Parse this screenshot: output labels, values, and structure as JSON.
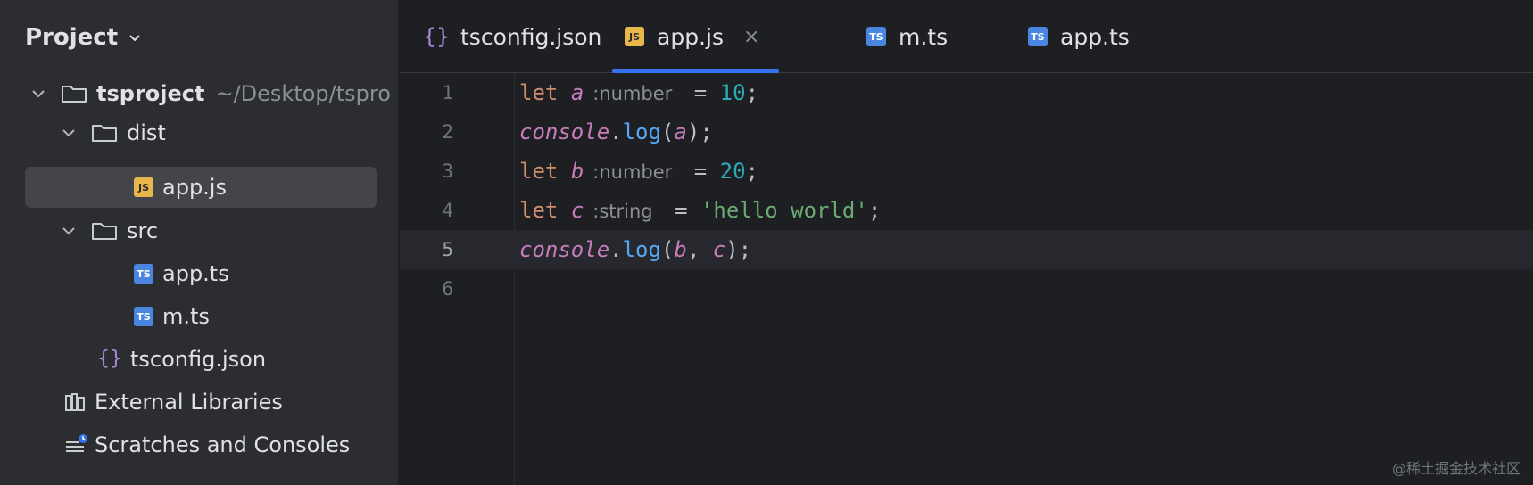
{
  "project_panel": {
    "title": "Project",
    "tree": {
      "root": {
        "name": "tsproject",
        "path": "~/Desktop/tspro"
      },
      "dist": {
        "name": "dist"
      },
      "dist_app_js": {
        "name": "app.js",
        "icon": "JS"
      },
      "src": {
        "name": "src"
      },
      "src_app_ts": {
        "name": "app.ts",
        "icon": "TS"
      },
      "src_m_ts": {
        "name": "m.ts",
        "icon": "TS"
      },
      "tsconfig": {
        "name": "tsconfig.json",
        "icon": "{}"
      },
      "external_libraries": {
        "name": "External Libraries"
      },
      "scratches": {
        "name": "Scratches and Consoles"
      }
    }
  },
  "tabs": [
    {
      "label": "tsconfig.json",
      "icon": "{}"
    },
    {
      "label": "app.js",
      "icon": "JS",
      "close": "×"
    },
    {
      "label": "m.ts",
      "icon": "TS"
    },
    {
      "label": "app.ts",
      "icon": "TS"
    }
  ],
  "editor": {
    "line_numbers": [
      "1",
      "2",
      "3",
      "4",
      "5",
      "6"
    ],
    "current_line": 5,
    "lines": {
      "l1": {
        "kw": "let",
        "var": "a",
        "hint": ":number",
        "op": " = ",
        "val": "10",
        "end": ";"
      },
      "l2": {
        "obj": "console",
        "dot": ".",
        "fn": "log",
        "open": "(",
        "arg": "a",
        "close": ");"
      },
      "l3": {
        "kw": "let",
        "var": "b",
        "hint": ":number",
        "op": " = ",
        "val": "20",
        "end": ";"
      },
      "l4": {
        "kw": "let",
        "var": "c",
        "hint": ":string",
        "op": " = ",
        "val": "'hello world'",
        "end": ";"
      },
      "l5": {
        "obj": "console",
        "dot": ".",
        "fn": "log",
        "open": "(",
        "arg1": "b",
        "sep": ", ",
        "arg2": "c",
        "close": ");"
      }
    }
  },
  "watermark": "@稀土掘金技术社区",
  "colors": {
    "panel_bg": "#2b2d30",
    "editor_bg": "#1e1f22",
    "accent": "#3574f0",
    "keyword": "#cf8e6d",
    "variable": "#c77dbb",
    "function": "#56a8f5",
    "number": "#2aacb8",
    "string": "#6aab73"
  }
}
